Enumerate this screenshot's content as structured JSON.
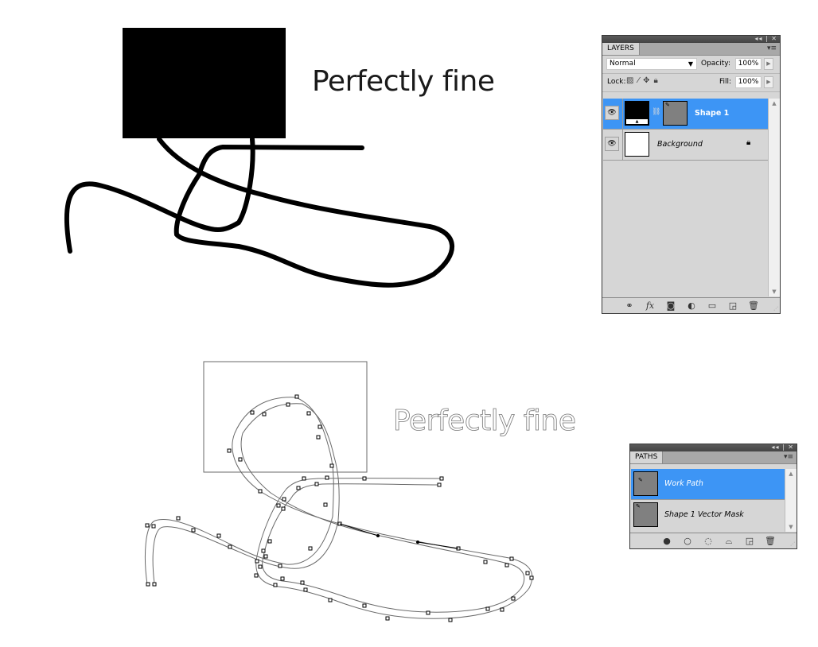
{
  "canvas": {
    "top_text": "Perfectly fine",
    "bottom_text": "Perfectly fine",
    "shape_fill": "#000000",
    "outline_color": "#6a6a6a"
  },
  "layers_panel": {
    "tab_label": "LAYERS",
    "window_controls": "◂◂ | ✕",
    "menu_icon": "▾≡",
    "blend_mode": "Normal",
    "opacity_label": "Opacity:",
    "opacity_value": "100%",
    "lock_label": "Lock:",
    "fill_label": "Fill:",
    "fill_value": "100%",
    "layers": [
      {
        "name": "Shape 1",
        "selected": true,
        "visible": true,
        "locked": false
      },
      {
        "name": "Background",
        "selected": false,
        "visible": true,
        "locked": true
      }
    ],
    "footer_icons": [
      "link-icon",
      "fx-icon",
      "mask-icon",
      "adjustment-icon",
      "folder-icon",
      "new-layer-icon",
      "trash-icon"
    ],
    "selection_color": "#3d95f5"
  },
  "paths_panel": {
    "tab_label": "PATHS",
    "window_controls": "◂◂ | ✕",
    "menu_icon": "▾≡",
    "paths": [
      {
        "name": "Work Path",
        "selected": true
      },
      {
        "name": "Shape 1 Vector Mask",
        "selected": false
      }
    ],
    "footer_icons": [
      "fill-path-icon",
      "stroke-path-icon",
      "load-selection-icon",
      "make-work-path-icon",
      "new-path-icon",
      "trash-icon"
    ]
  }
}
